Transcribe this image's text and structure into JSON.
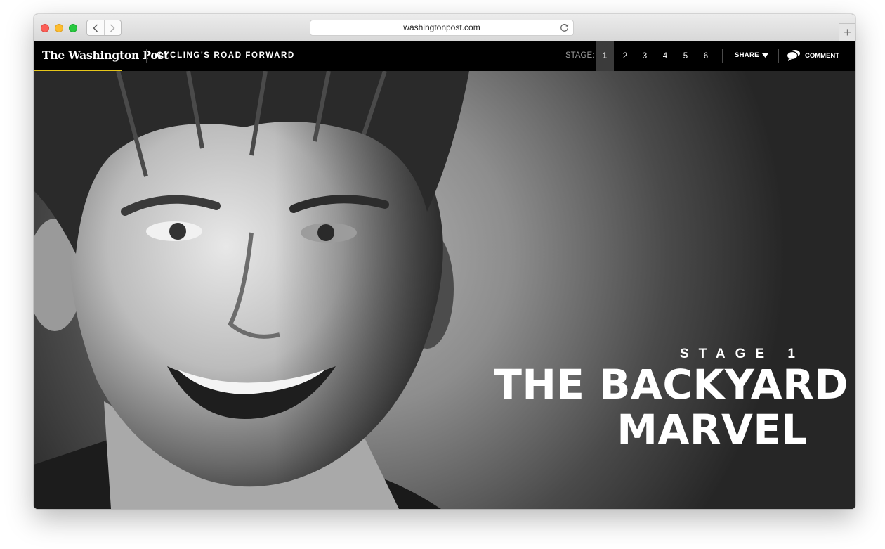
{
  "browser": {
    "url": "washingtonpost.com"
  },
  "site": {
    "logo_text": "The Washington Post",
    "section_title": "CYCLING'S ROAD FORWARD",
    "stage_label": "STAGE:",
    "stages": [
      "1",
      "2",
      "3",
      "4",
      "5",
      "6"
    ],
    "active_stage": "1",
    "share_label": "SHARE",
    "comment_label": "COMMENT",
    "accent_color": "#e6c619"
  },
  "hero": {
    "kicker": "STAGE 1",
    "headline_line1": "THE BACKYARD",
    "headline_line2": "MARVEL"
  },
  "icons": [
    "back-icon",
    "forward-icon",
    "reload-icon",
    "plus-icon",
    "caret-down-icon",
    "comment-bubble-icon"
  ]
}
